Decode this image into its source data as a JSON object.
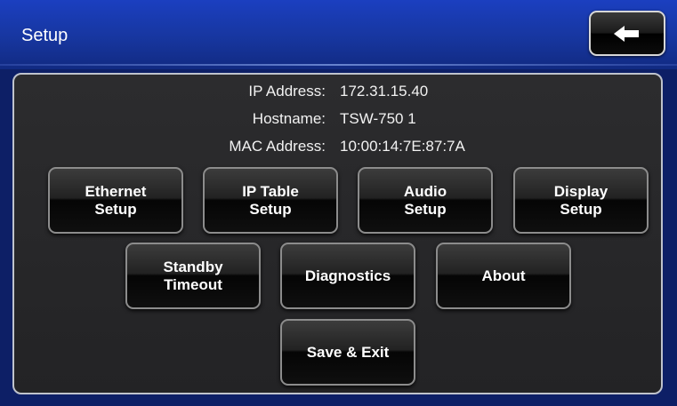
{
  "header": {
    "title": "Setup",
    "back_icon": "back-arrow-icon"
  },
  "info": {
    "ip_label": "IP Address:",
    "ip_value": "172.31.15.40",
    "host_label": "Hostname:",
    "host_value": "TSW-750 1",
    "mac_label": "MAC Address:",
    "mac_value": "10:00:14:7E:87:7A"
  },
  "buttons": {
    "ethernet": "Ethernet\nSetup",
    "ip_table": "IP Table\nSetup",
    "audio": "Audio\nSetup",
    "display": "Display\nSetup",
    "standby": "Standby\nTimeout",
    "diagnostics": "Diagnostics",
    "about": "About",
    "save_exit": "Save & Exit"
  },
  "colors": {
    "header": "#1b3fc0",
    "panel": "#2c2c2e",
    "button_border": "#8c8c8c"
  }
}
